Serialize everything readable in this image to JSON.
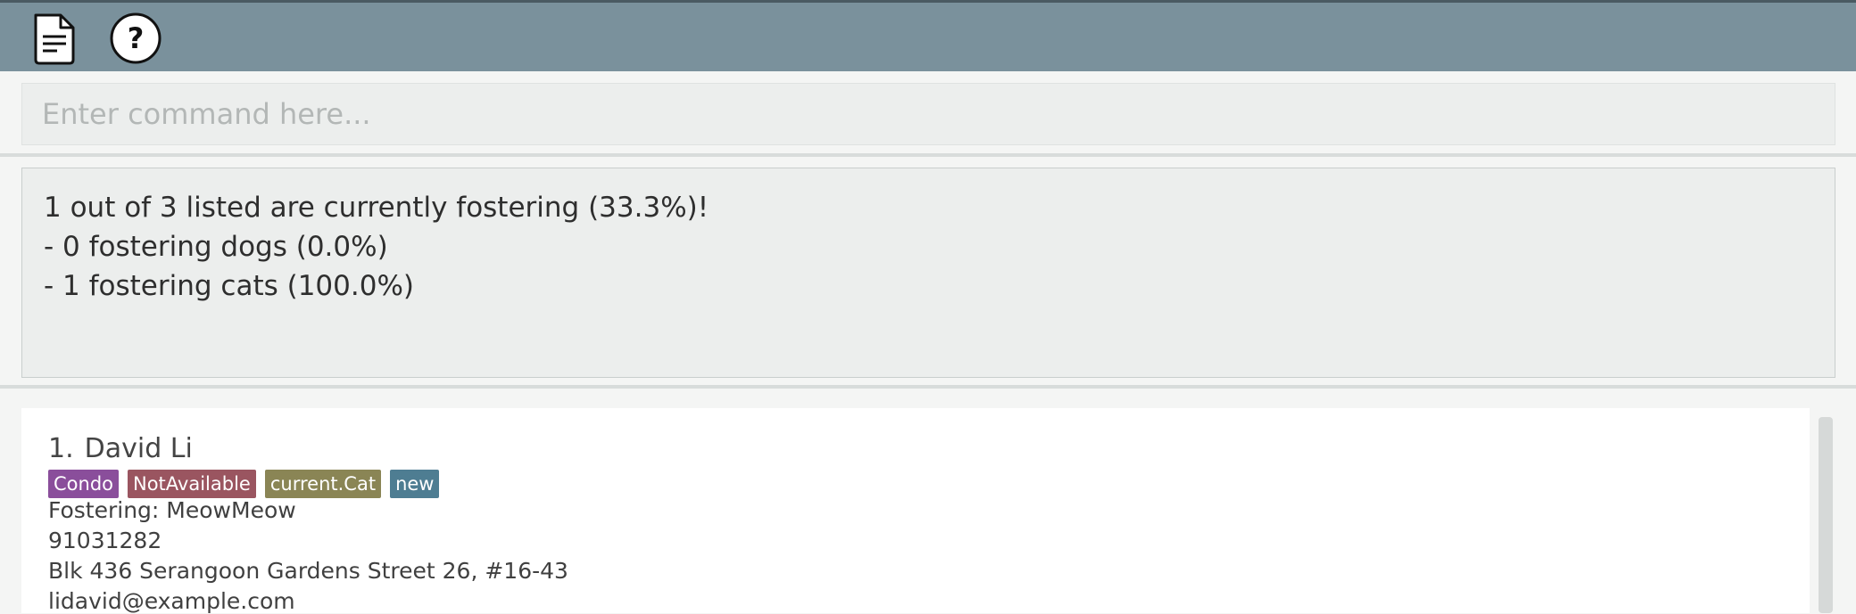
{
  "toolbar": {
    "icons": [
      "document-icon",
      "help-icon"
    ]
  },
  "command": {
    "placeholder": "Enter command here...",
    "value": ""
  },
  "result": {
    "lines": [
      "1 out of 3 listed are currently fostering (33.3%)!",
      "- 0 fostering dogs (0.0%)",
      "- 1 fostering cats (100.0%)"
    ]
  },
  "persons": [
    {
      "index": "1.",
      "name": "David Li",
      "tags": [
        {
          "label": "Condo",
          "color": "#8a4e9b"
        },
        {
          "label": "NotAvailable",
          "color": "#9a5560"
        },
        {
          "label": "current.Cat",
          "color": "#8a8555"
        },
        {
          "label": "new",
          "color": "#4e7d92"
        }
      ],
      "fostering": "Fostering: MeowMeow",
      "phone": "91031282",
      "address": "Blk 436 Serangoon Gardens Street 26, #16-43",
      "email": "lidavid@example.com"
    }
  ]
}
